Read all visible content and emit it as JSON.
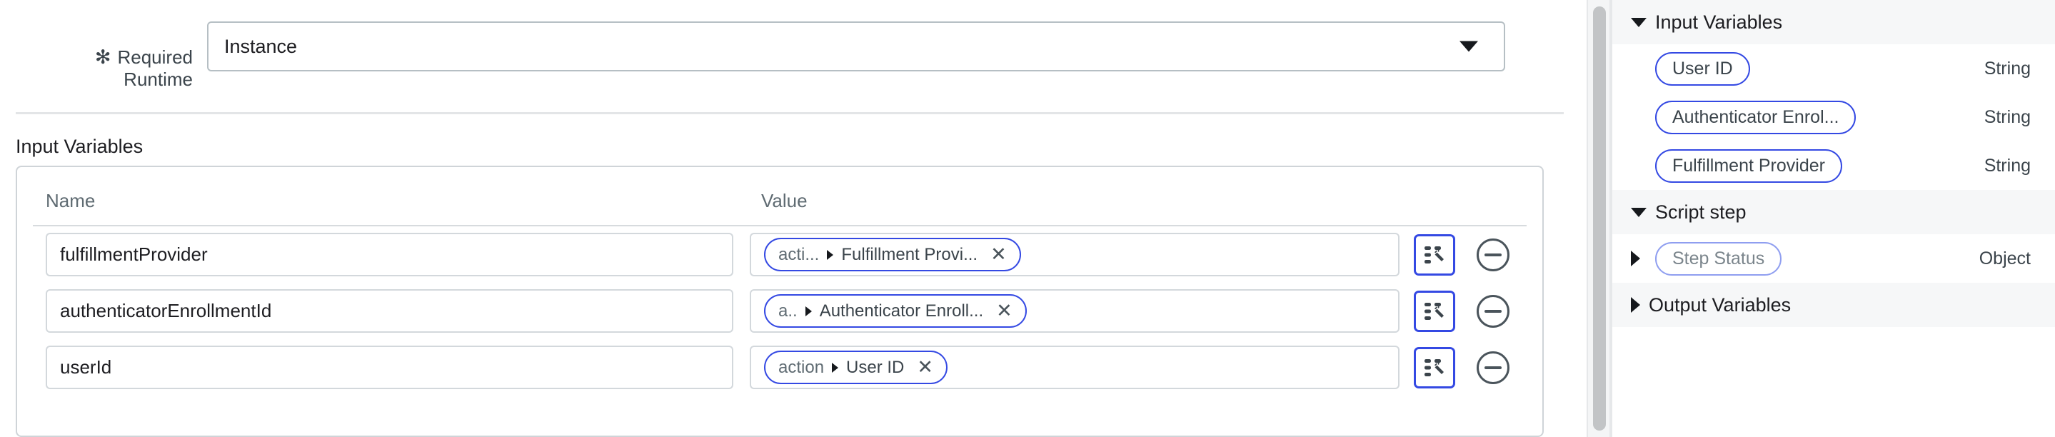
{
  "form": {
    "required_marker": "✻",
    "runtime_label": "Required\nRuntime",
    "runtime_value": "Instance",
    "section_title": "Input Variables"
  },
  "table": {
    "columns": [
      "Name",
      "Value"
    ],
    "rows": [
      {
        "name": "fulfillmentProvider",
        "chip_scope": "acti...",
        "chip_name": "Fulfillment Provi...",
        "chip_remove": "✕",
        "wand_title": "wand-icon",
        "remove_title": "remove-row"
      },
      {
        "name": "authenticatorEnrollmentId",
        "chip_scope": "a..",
        "chip_name": "Authenticator Enroll...",
        "chip_remove": "✕",
        "wand_title": "wand-icon",
        "remove_title": "remove-row"
      },
      {
        "name": "userId",
        "chip_scope": "action",
        "chip_name": "User ID",
        "chip_remove": "✕",
        "wand_title": "wand-icon",
        "remove_title": "remove-row"
      }
    ]
  },
  "sidebar": {
    "groups": [
      {
        "title": "Input Variables",
        "expanded": true,
        "items": [
          {
            "label": "User ID",
            "type": "String",
            "expandable": false,
            "muted": false
          },
          {
            "label": "Authenticator Enrol...",
            "type": "String",
            "expandable": false,
            "muted": false
          },
          {
            "label": "Fulfillment Provider",
            "type": "String",
            "expandable": false,
            "muted": false
          }
        ]
      },
      {
        "title": "Script step",
        "expanded": true,
        "items": [
          {
            "label": "Step Status",
            "type": "Object",
            "expandable": true,
            "muted": true
          }
        ]
      },
      {
        "title": "Output Variables",
        "expanded": false,
        "items": []
      }
    ]
  },
  "colors": {
    "accent_blue": "#3449e3",
    "muted_blue": "#8f9ef0",
    "border_grey": "#cfd4d8",
    "header_bg": "#f6f7f8",
    "text": "#1d1d21",
    "text_muted": "#5f6b72"
  }
}
